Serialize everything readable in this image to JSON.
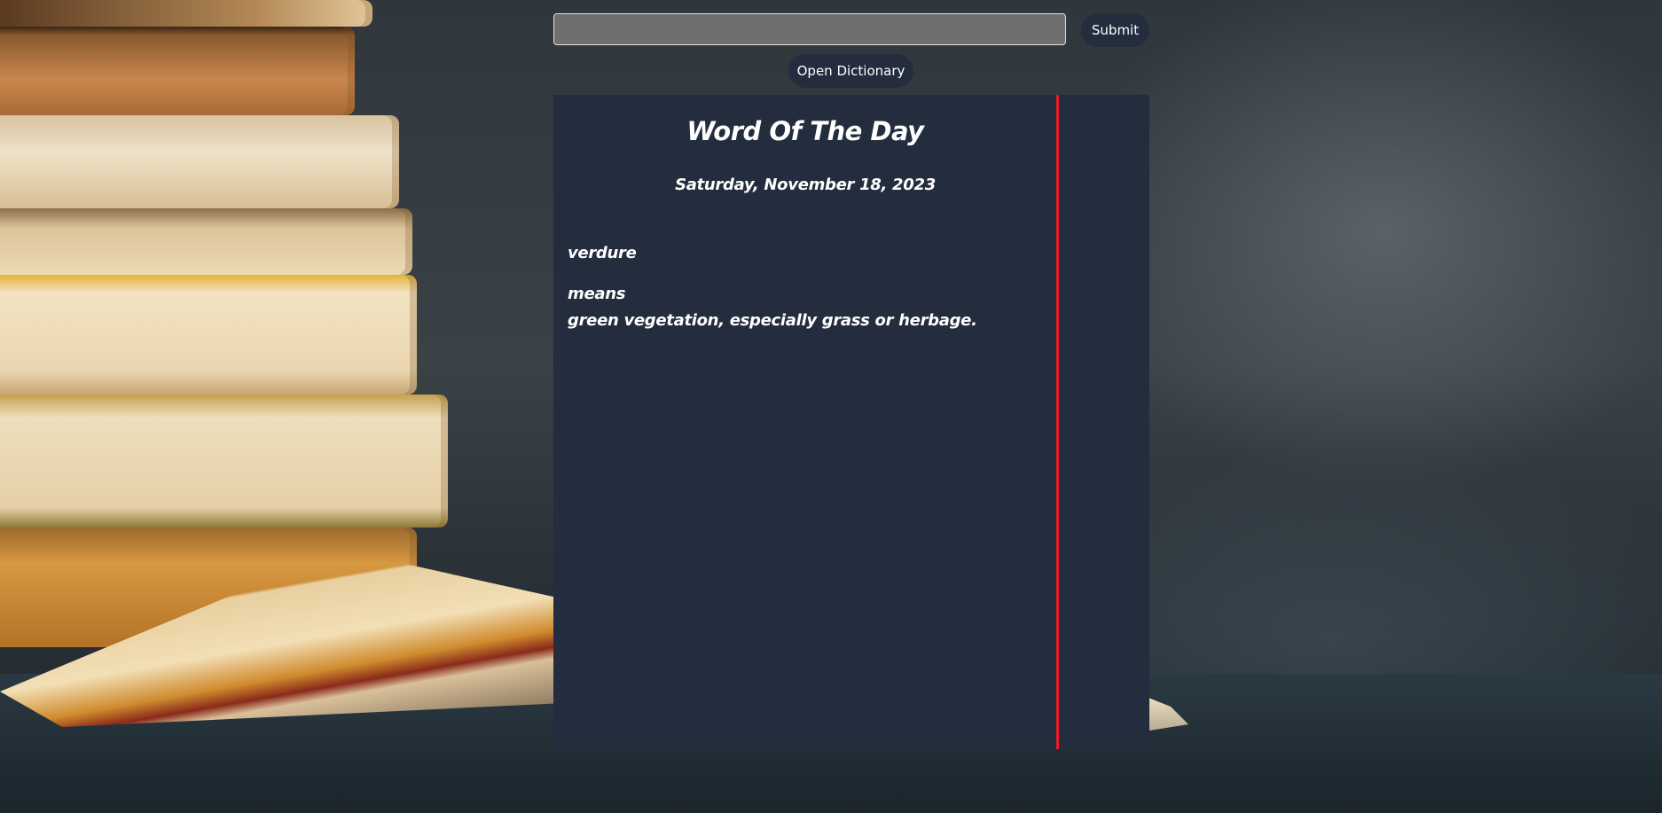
{
  "search": {
    "value": "",
    "placeholder": ""
  },
  "buttons": {
    "submit_label": "Submit",
    "open_dictionary_label": "Open Dictionary"
  },
  "word_of_the_day": {
    "title": "Word Of The Day",
    "date": "Saturday, November 18, 2023",
    "word": "verdure",
    "means_label": "means",
    "definition": "green vegetation, especially grass or herbage."
  },
  "colors": {
    "card_background": "#232d3e",
    "divider": "#ec1c24",
    "input_background": "#6f6f6f",
    "button_background": "#232d3e",
    "text": "#ffffff"
  }
}
